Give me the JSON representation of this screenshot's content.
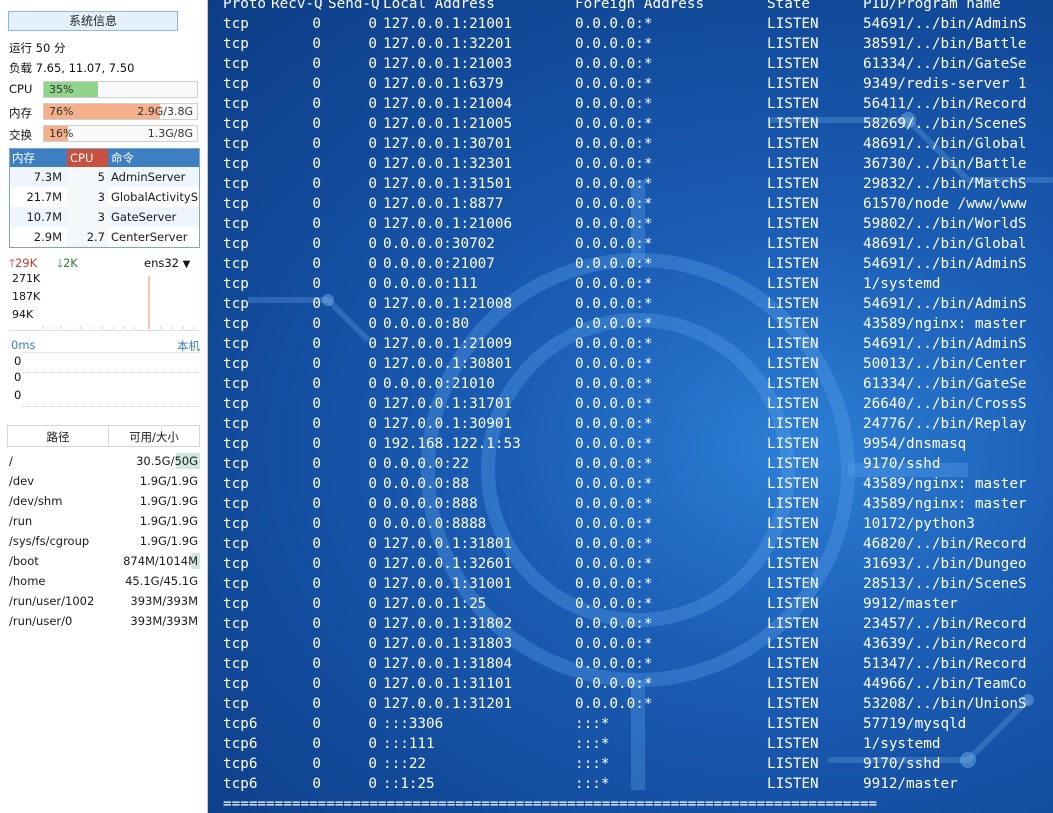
{
  "panel": {
    "title": "系统信息",
    "uptime": "运行 50 分",
    "load": "负载 7.65, 11.07, 7.50",
    "cpu": {
      "label": "CPU",
      "percent": "35%",
      "fraction": 0.35,
      "color": "#8fd48a"
    },
    "mem": {
      "label": "内存",
      "percent": "76%",
      "value": "2.9G/3.8G",
      "fraction": 0.76,
      "color": "#f4b08a"
    },
    "swap": {
      "label": "交换",
      "percent": "16%",
      "value": "1.3G/8G",
      "fraction": 0.16,
      "color": "#f4b08a"
    },
    "proc_headers": {
      "mem": "内存",
      "cpu": "CPU",
      "cmd": "命令"
    },
    "procs": [
      {
        "mem": "7.3M",
        "cpu": "5",
        "cmd": "AdminServer"
      },
      {
        "mem": "21.7M",
        "cpu": "3",
        "cmd": "GlobalActivityS"
      },
      {
        "mem": "10.7M",
        "cpu": "3",
        "cmd": "GateServer"
      },
      {
        "mem": "2.9M",
        "cpu": "2.7",
        "cmd": "CenterServer"
      }
    ],
    "net": {
      "up": "29K",
      "down": "2K",
      "interface": "ens32",
      "ticks": [
        "271K",
        "187K",
        "94K"
      ]
    },
    "latency": {
      "label": "0ms",
      "local": "本机",
      "values": [
        "0",
        "0",
        "0"
      ]
    },
    "disk_headers": {
      "path": "路径",
      "size": "可用/大小"
    },
    "disks": [
      {
        "path": "/",
        "size": "30.5G/50G",
        "used_fraction": 0.39
      },
      {
        "path": "/dev",
        "size": "1.9G/1.9G",
        "used_fraction": 0.0
      },
      {
        "path": "/dev/shm",
        "size": "1.9G/1.9G",
        "used_fraction": 0.0
      },
      {
        "path": "/run",
        "size": "1.9G/1.9G",
        "used_fraction": 0.0
      },
      {
        "path": "/sys/fs/cgroup",
        "size": "1.9G/1.9G",
        "used_fraction": 0.0
      },
      {
        "path": "/boot",
        "size": "874M/1014M",
        "used_fraction": 0.14
      },
      {
        "path": "/home",
        "size": "45.1G/45.1G",
        "used_fraction": 0.0
      },
      {
        "path": "/run/user/1002",
        "size": "393M/393M",
        "used_fraction": 0.0
      },
      {
        "path": "/run/user/0",
        "size": "393M/393M",
        "used_fraction": 0.0
      }
    ]
  },
  "terminal": {
    "header": {
      "proto": "Proto",
      "recv": "Recv-Q",
      "send": "Send-Q",
      "local": "Local Address",
      "foreign": "Foreign Address",
      "state": "State",
      "pid": "PID/Program name"
    },
    "rows": [
      [
        "tcp",
        "0",
        "0",
        "127.0.0.1:21001",
        "0.0.0.0:*",
        "LISTEN",
        "54691/../bin/AdminS"
      ],
      [
        "tcp",
        "0",
        "0",
        "127.0.0.1:32201",
        "0.0.0.0:*",
        "LISTEN",
        "38591/../bin/Battle"
      ],
      [
        "tcp",
        "0",
        "0",
        "127.0.0.1:21003",
        "0.0.0.0:*",
        "LISTEN",
        "61334/../bin/GateSe"
      ],
      [
        "tcp",
        "0",
        "0",
        "127.0.0.1:6379",
        "0.0.0.0:*",
        "LISTEN",
        "9349/redis-server 1"
      ],
      [
        "tcp",
        "0",
        "0",
        "127.0.0.1:21004",
        "0.0.0.0:*",
        "LISTEN",
        "56411/../bin/Record"
      ],
      [
        "tcp",
        "0",
        "0",
        "127.0.0.1:21005",
        "0.0.0.0:*",
        "LISTEN",
        "58269/../bin/SceneS"
      ],
      [
        "tcp",
        "0",
        "0",
        "127.0.0.1:30701",
        "0.0.0.0:*",
        "LISTEN",
        "48691/../bin/Global"
      ],
      [
        "tcp",
        "0",
        "0",
        "127.0.0.1:32301",
        "0.0.0.0:*",
        "LISTEN",
        "36730/../bin/Battle"
      ],
      [
        "tcp",
        "0",
        "0",
        "127.0.0.1:31501",
        "0.0.0.0:*",
        "LISTEN",
        "29832/../bin/MatchS"
      ],
      [
        "tcp",
        "0",
        "0",
        "127.0.0.1:8877",
        "0.0.0.0:*",
        "LISTEN",
        "61570/node /www/www"
      ],
      [
        "tcp",
        "0",
        "0",
        "127.0.0.1:21006",
        "0.0.0.0:*",
        "LISTEN",
        "59802/../bin/WorldS"
      ],
      [
        "tcp",
        "0",
        "0",
        "0.0.0.0:30702",
        "0.0.0.0:*",
        "LISTEN",
        "48691/../bin/Global"
      ],
      [
        "tcp",
        "0",
        "0",
        "0.0.0.0:21007",
        "0.0.0.0:*",
        "LISTEN",
        "54691/../bin/AdminS"
      ],
      [
        "tcp",
        "0",
        "0",
        "0.0.0.0:111",
        "0.0.0.0:*",
        "LISTEN",
        "1/systemd"
      ],
      [
        "tcp",
        "0",
        "0",
        "127.0.0.1:21008",
        "0.0.0.0:*",
        "LISTEN",
        "54691/../bin/AdminS"
      ],
      [
        "tcp",
        "0",
        "0",
        "0.0.0.0:80",
        "0.0.0.0:*",
        "LISTEN",
        "43589/nginx: master"
      ],
      [
        "tcp",
        "0",
        "0",
        "127.0.0.1:21009",
        "0.0.0.0:*",
        "LISTEN",
        "54691/../bin/AdminS"
      ],
      [
        "tcp",
        "0",
        "0",
        "127.0.0.1:30801",
        "0.0.0.0:*",
        "LISTEN",
        "50013/../bin/Center"
      ],
      [
        "tcp",
        "0",
        "0",
        "0.0.0.0:21010",
        "0.0.0.0:*",
        "LISTEN",
        "61334/../bin/GateSe"
      ],
      [
        "tcp",
        "0",
        "0",
        "127.0.0.1:31701",
        "0.0.0.0:*",
        "LISTEN",
        "26640/../bin/CrossS"
      ],
      [
        "tcp",
        "0",
        "0",
        "127.0.0.1:30901",
        "0.0.0.0:*",
        "LISTEN",
        "24776/../bin/Replay"
      ],
      [
        "tcp",
        "0",
        "0",
        "192.168.122.1:53",
        "0.0.0.0:*",
        "LISTEN",
        "9954/dnsmasq"
      ],
      [
        "tcp",
        "0",
        "0",
        "0.0.0.0:22",
        "0.0.0.0:*",
        "LISTEN",
        "9170/sshd"
      ],
      [
        "tcp",
        "0",
        "0",
        "0.0.0.0:88",
        "0.0.0.0:*",
        "LISTEN",
        "43589/nginx: master"
      ],
      [
        "tcp",
        "0",
        "0",
        "0.0.0.0:888",
        "0.0.0.0:*",
        "LISTEN",
        "43589/nginx: master"
      ],
      [
        "tcp",
        "0",
        "0",
        "0.0.0.0:8888",
        "0.0.0.0:*",
        "LISTEN",
        "10172/python3"
      ],
      [
        "tcp",
        "0",
        "0",
        "127.0.0.1:31801",
        "0.0.0.0:*",
        "LISTEN",
        "46820/../bin/Record"
      ],
      [
        "tcp",
        "0",
        "0",
        "127.0.0.1:32601",
        "0.0.0.0:*",
        "LISTEN",
        "31693/../bin/Dungeo"
      ],
      [
        "tcp",
        "0",
        "0",
        "127.0.0.1:31001",
        "0.0.0.0:*",
        "LISTEN",
        "28513/../bin/SceneS"
      ],
      [
        "tcp",
        "0",
        "0",
        "127.0.0.1:25",
        "0.0.0.0:*",
        "LISTEN",
        "9912/master"
      ],
      [
        "tcp",
        "0",
        "0",
        "127.0.0.1:31802",
        "0.0.0.0:*",
        "LISTEN",
        "23457/../bin/Record"
      ],
      [
        "tcp",
        "0",
        "0",
        "127.0.0.1:31803",
        "0.0.0.0:*",
        "LISTEN",
        "43639/../bin/Record"
      ],
      [
        "tcp",
        "0",
        "0",
        "127.0.0.1:31804",
        "0.0.0.0:*",
        "LISTEN",
        "51347/../bin/Record"
      ],
      [
        "tcp",
        "0",
        "0",
        "127.0.0.1:31101",
        "0.0.0.0:*",
        "LISTEN",
        "44966/../bin/TeamCo"
      ],
      [
        "tcp",
        "0",
        "0",
        "127.0.0.1:31201",
        "0.0.0.0:*",
        "LISTEN",
        "53208/../bin/UnionS"
      ],
      [
        "tcp6",
        "0",
        "0",
        ":::3306",
        ":::*",
        "LISTEN",
        "57719/mysqld"
      ],
      [
        "tcp6",
        "0",
        "0",
        ":::111",
        ":::*",
        "LISTEN",
        "1/systemd"
      ],
      [
        "tcp6",
        "0",
        "0",
        ":::22",
        ":::*",
        "LISTEN",
        "9170/sshd"
      ],
      [
        "tcp6",
        "0",
        "0",
        "::1:25",
        ":::*",
        "LISTEN",
        "9912/master"
      ]
    ],
    "separator": "============================================================================"
  }
}
